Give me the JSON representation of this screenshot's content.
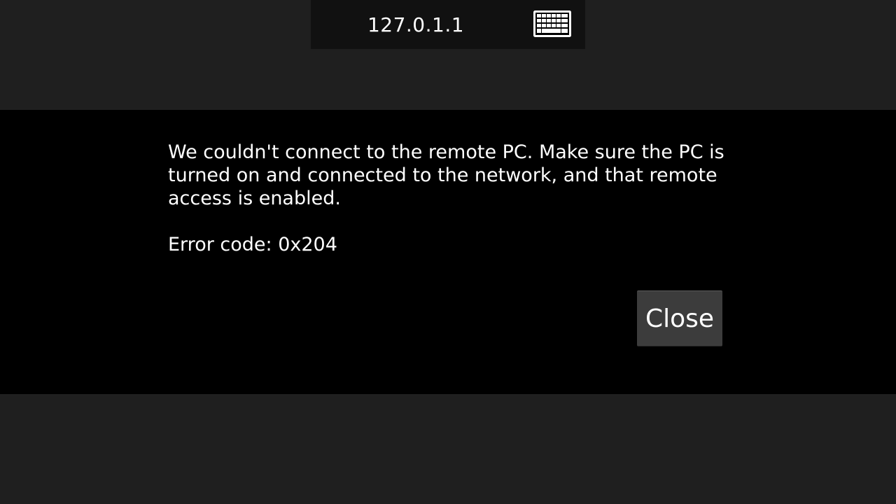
{
  "topbar": {
    "host": "127.0.1.1",
    "keyboard_icon": "keyboard-icon"
  },
  "dialog": {
    "message": "We couldn't connect to the remote PC. Make sure the PC is turned on and connected to the network, and that remote access is enabled.",
    "error_code": "Error code: 0x204",
    "close_label": "Close"
  },
  "colors": {
    "background": "#1f1f1f",
    "topbar": "#111111",
    "dialog": "#000000",
    "button": "#3c3c3c",
    "text": "#ffffff"
  }
}
